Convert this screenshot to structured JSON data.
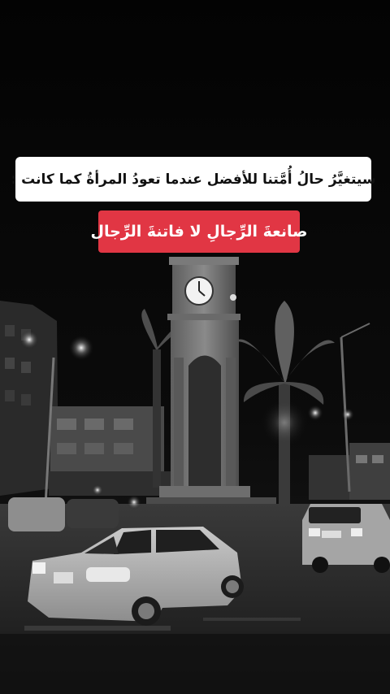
{
  "captions": {
    "line1": "سيتغيَّرُ حالُ أُمَّتنا للأفضل عندما تعودُ المرأةُ كما كانت :",
    "line2": "صانعةَ الرِّجالِ لا فاتنةَ الرِّجال"
  },
  "colors": {
    "caption_bg": "#ffffff",
    "caption_text": "#111111",
    "highlight_bg": "#e13644",
    "highlight_text": "#ffffff",
    "sky": "#050505"
  },
  "scene": {
    "icons": [
      "clock-tower-icon",
      "palm-tree-icon",
      "car-icon",
      "street-lamp-icon",
      "building-icon"
    ]
  }
}
